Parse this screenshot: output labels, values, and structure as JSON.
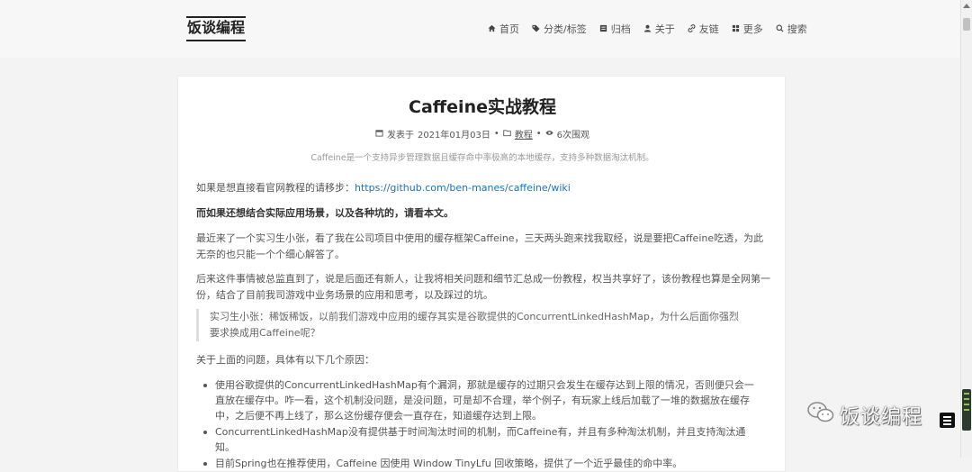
{
  "header": {
    "brand": "饭谈编程",
    "nav": [
      {
        "label": "首页",
        "icon": "home-icon"
      },
      {
        "label": "分类/标签",
        "icon": "tag-icon"
      },
      {
        "label": "归档",
        "icon": "archive-icon"
      },
      {
        "label": "关于",
        "icon": "user-icon"
      },
      {
        "label": "友链",
        "icon": "link-icon"
      },
      {
        "label": "更多",
        "icon": "grid-icon"
      },
      {
        "label": "搜索",
        "icon": "search-icon"
      }
    ]
  },
  "post": {
    "title": "Caffeine实战教程",
    "meta": {
      "posted_prefix": "发表于",
      "date": "2021年01月03日",
      "category": "教程",
      "views": "6次围观"
    },
    "description": "Caffeine是一个支持异步管理数据且缓存命中率极高的本地缓存，支持多种数据淘汰机制。",
    "p1_text": "如果是想直接看官网教程的请移步：",
    "p1_link": "https://github.com/ben-manes/caffeine/wiki",
    "p2": "而如果还想结合实际应用场景，以及各种坑的，请看本文。",
    "p3": "最近来了一个实习生小张，看了我在公司项目中使用的缓存框架Caffeine，三天两头跑来找我取经，说是要把Caffeine吃透，为此无奈的也只能一个个细心解答了。",
    "p4": "后来这件事情被总监直到了，说是后面还有新人，让我将相关问题和细节汇总成一份教程，权当共享好了，该份教程也算是全网第一份，结合了目前我司游戏中业务场景的应用和思考，以及踩过的坑。",
    "quote": "实习生小张：稀饭稀饭，以前我们游戏中应用的缓存其实是谷歌提供的ConcurrentLinkedHashMap，为什么后面你强烈要求换成用Caffeine呢？",
    "p5": "关于上面的问题，具体有以下几个原因：",
    "list": [
      "使用谷歌提供的ConcurrentLinkedHashMap有个漏洞，那就是缓存的过期只会发生在缓存达到上限的情况，否则便只会一直放在缓存中。咋一看，这个机制没问题，是没问题，可是却不合理，举个例子，有玩家上线后加载了一堆的数据放在缓存中，之后便不再上线了，那么这份缓存便会一直存在，知道缓存达到上限。",
      "ConcurrentLinkedHashMap没有提供基于时间淘汰时间的机制，而Caffeine有，并且有多种淘汰机制，并且支持淘汰通知。",
      "目前Spring也在推荐使用，Caffeine 因使用 Window TinyLfu 回收策略，提供了一个近乎最佳的命中率。"
    ]
  },
  "watermark": "饭谈编程"
}
